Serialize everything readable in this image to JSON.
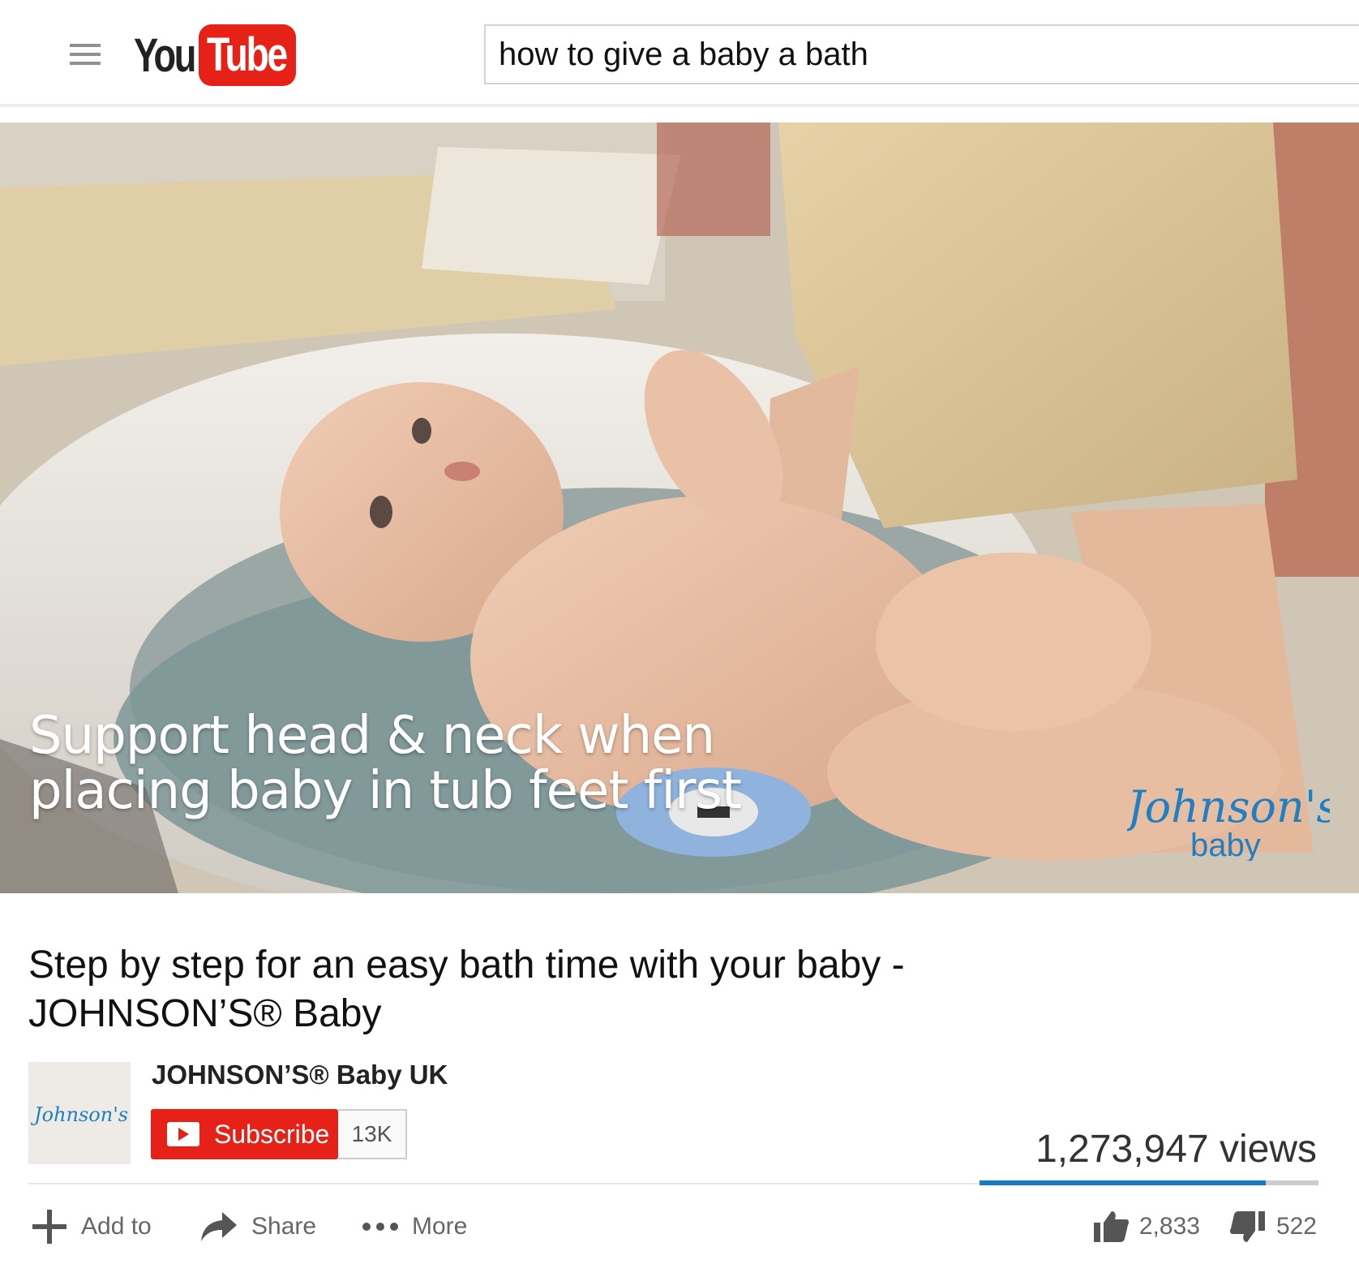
{
  "header": {
    "logo_you": "You",
    "logo_tube": "Tube",
    "search_value": "how to give a baby a bath"
  },
  "video": {
    "caption_line1": "Support head & neck when",
    "caption_line2": "placing baby in tub feet first",
    "watermark_brand": "Johnson's",
    "watermark_sub": "baby"
  },
  "info": {
    "title_line1": "Step by step for an easy bath time with your baby -",
    "title_line2": "JOHNSON’S® Baby",
    "channel_name": "JOHNSON’S® Baby UK",
    "channel_thumb_text": "Johnson's",
    "subscribe_label": "Subscribe",
    "subscriber_count": "13K",
    "views": "1,273,947 views",
    "like_ratio": 0.845
  },
  "actions": {
    "add_to": "Add to",
    "share": "Share",
    "more": "More",
    "likes": "2,833",
    "dislikes": "522"
  },
  "colors": {
    "brand_red": "#e62117",
    "accent_blue": "#167ac6",
    "watermark_blue": "#1f7fc4"
  }
}
